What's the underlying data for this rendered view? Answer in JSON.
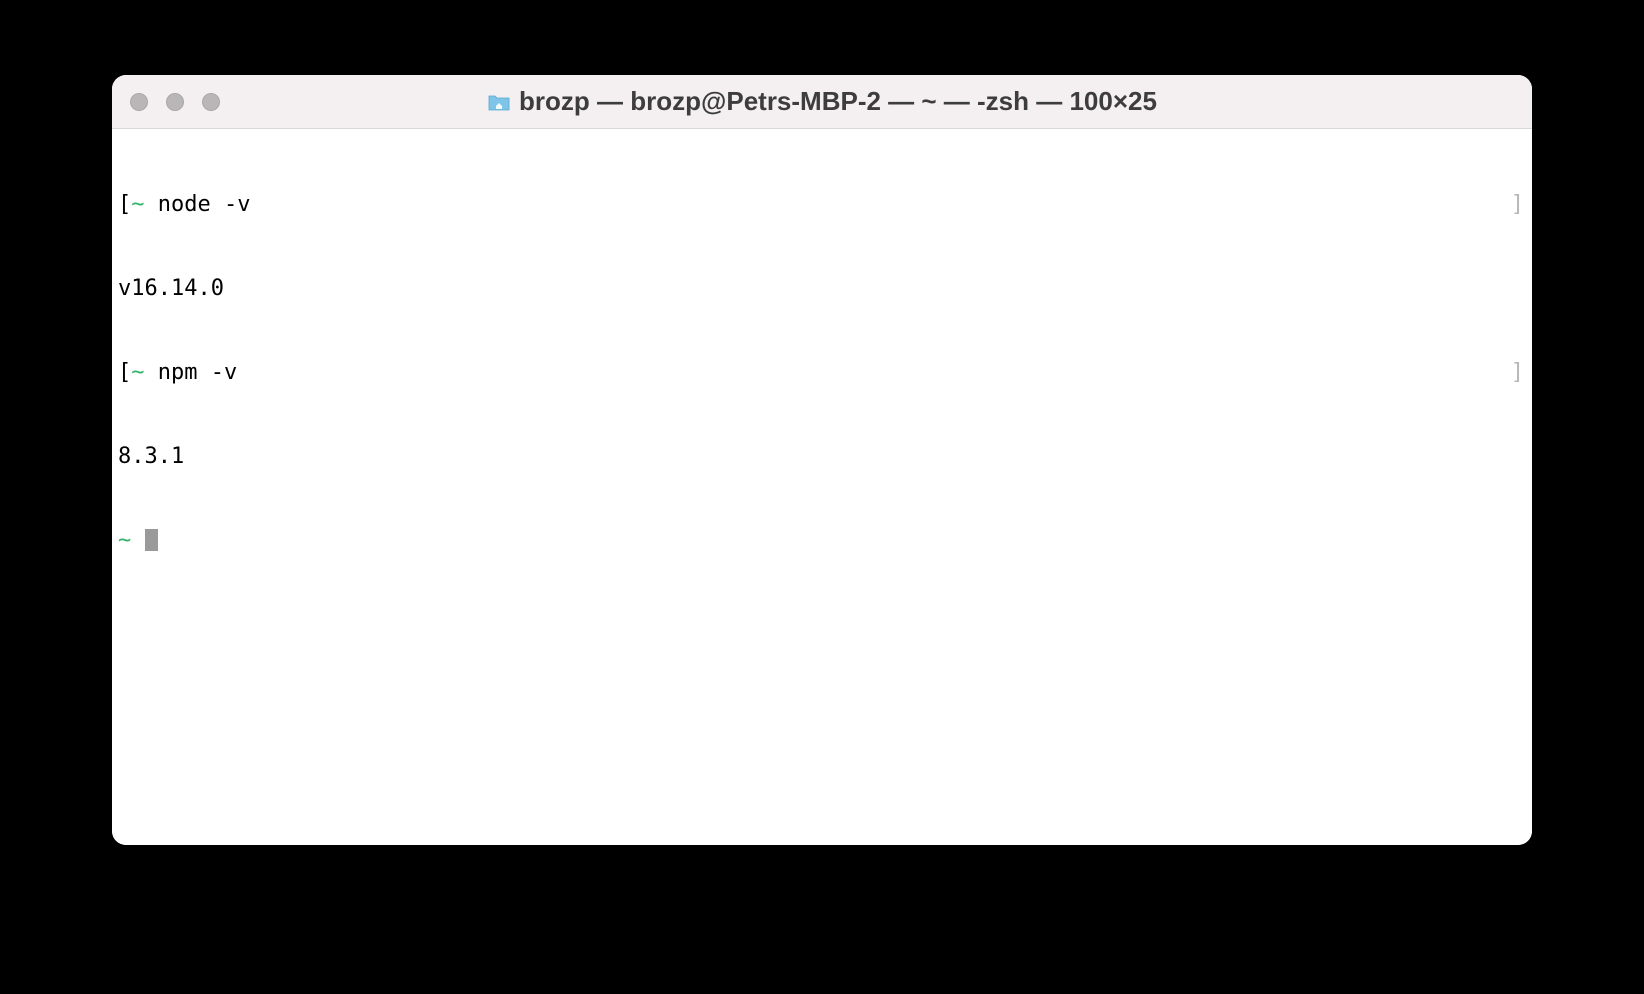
{
  "window": {
    "title": "brozp — brozp@Petrs-MBP-2 — ~ — -zsh — 100×25"
  },
  "terminal": {
    "lines": [
      {
        "left_bracket": "[",
        "prompt": "~",
        "command": "node -v",
        "right_bracket": "]"
      },
      {
        "output": "v16.14.0"
      },
      {
        "left_bracket": "[",
        "prompt": "~",
        "command": "npm -v",
        "right_bracket": "]"
      },
      {
        "output": "8.3.1"
      },
      {
        "prompt": "~",
        "cursor": true
      }
    ]
  }
}
